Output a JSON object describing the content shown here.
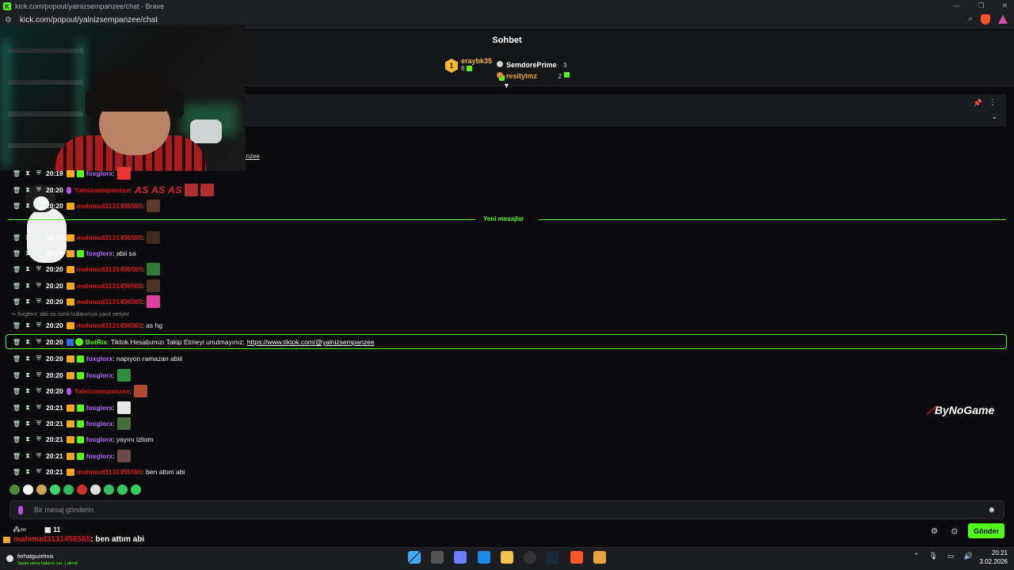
{
  "browser": {
    "title": "kick.com/popout/yalnizsempanzee/chat - Brave",
    "url": "kick.com/popout/yalnizsempanzee/chat"
  },
  "chat": {
    "header": "Sohbet",
    "pinned_user_partial": "anzee"
  },
  "leaderboard": {
    "rank": "1",
    "first": {
      "name": "eraybk35",
      "count": "8"
    },
    "second": {
      "name": "SemdorePrime",
      "count": "3"
    },
    "third": {
      "name": "resitylmz",
      "count": "2"
    }
  },
  "new_messages_label": "Yeni mesajlar",
  "reply_hint": "foxglorx: abii sa isimli kullanıcıya yanıt veriyor",
  "messages": [
    {
      "time": "20:19",
      "user": "foxglorx",
      "text": ":"
    },
    {
      "time": "20:20",
      "user": "Yalnizsempanzee",
      "text": ":",
      "big": "AS AS AS"
    },
    {
      "time": "20:20",
      "user": "mahmud3131456565",
      "text": ":"
    },
    {
      "time": "20:20",
      "user": "mahmud3131456565",
      "text": ":"
    },
    {
      "time": "20:20",
      "user": "foxglorx",
      "text": ": abii sa"
    },
    {
      "time": "20:20",
      "user": "mahmud3131456565",
      "text": ":"
    },
    {
      "time": "20:20",
      "user": "mahmud3131456565",
      "text": ":"
    },
    {
      "time": "20:20",
      "user": "mahmud3131456565",
      "text": ":"
    },
    {
      "time": "20:20",
      "user": "mahmud3131456565",
      "text": ": as hg"
    },
    {
      "time": "20:20",
      "user": "BotRix",
      "text": ": Tiktok Hesabımızı Takip Etmeyi unutmayınız:",
      "link": "https://www.tiktok.com/@yalnizsempanzee"
    },
    {
      "time": "20:20",
      "user": "foxglorx",
      "text": ": napıyon ramazan abiii"
    },
    {
      "time": "20:20",
      "user": "foxglorx",
      "text": ":"
    },
    {
      "time": "20:20",
      "user": "Yalnizsempanzee",
      "text": ":"
    },
    {
      "time": "20:21",
      "user": "foxglorx",
      "text": ":"
    },
    {
      "time": "20:21",
      "user": "foxglorx",
      "text": ":"
    },
    {
      "time": "20:21",
      "user": "foxglorx",
      "text": ": yayını izliom"
    },
    {
      "time": "20:21",
      "user": "foxglorx",
      "text": ":"
    },
    {
      "time": "20:21",
      "user": "mahmud3131456565",
      "text": ": ben attım abi"
    }
  ],
  "input": {
    "placeholder": "Bir mesaj gönderin",
    "send": "Gönder"
  },
  "footer": {
    "count": "11",
    "overlay_user": "mahmud3131456565",
    "overlay_text": ": ben attım abi"
  },
  "watermark": "ByNoGame",
  "taskbar": {
    "user": "ferhatguzelmis",
    "sub": "Spam atma hakkını var :) almdı",
    "time": "20:21",
    "date": "3.02.2026"
  },
  "colors": {
    "kick_green": "#53fc18",
    "username_purple": "#b26cff",
    "username_red": "#d91a1a"
  }
}
